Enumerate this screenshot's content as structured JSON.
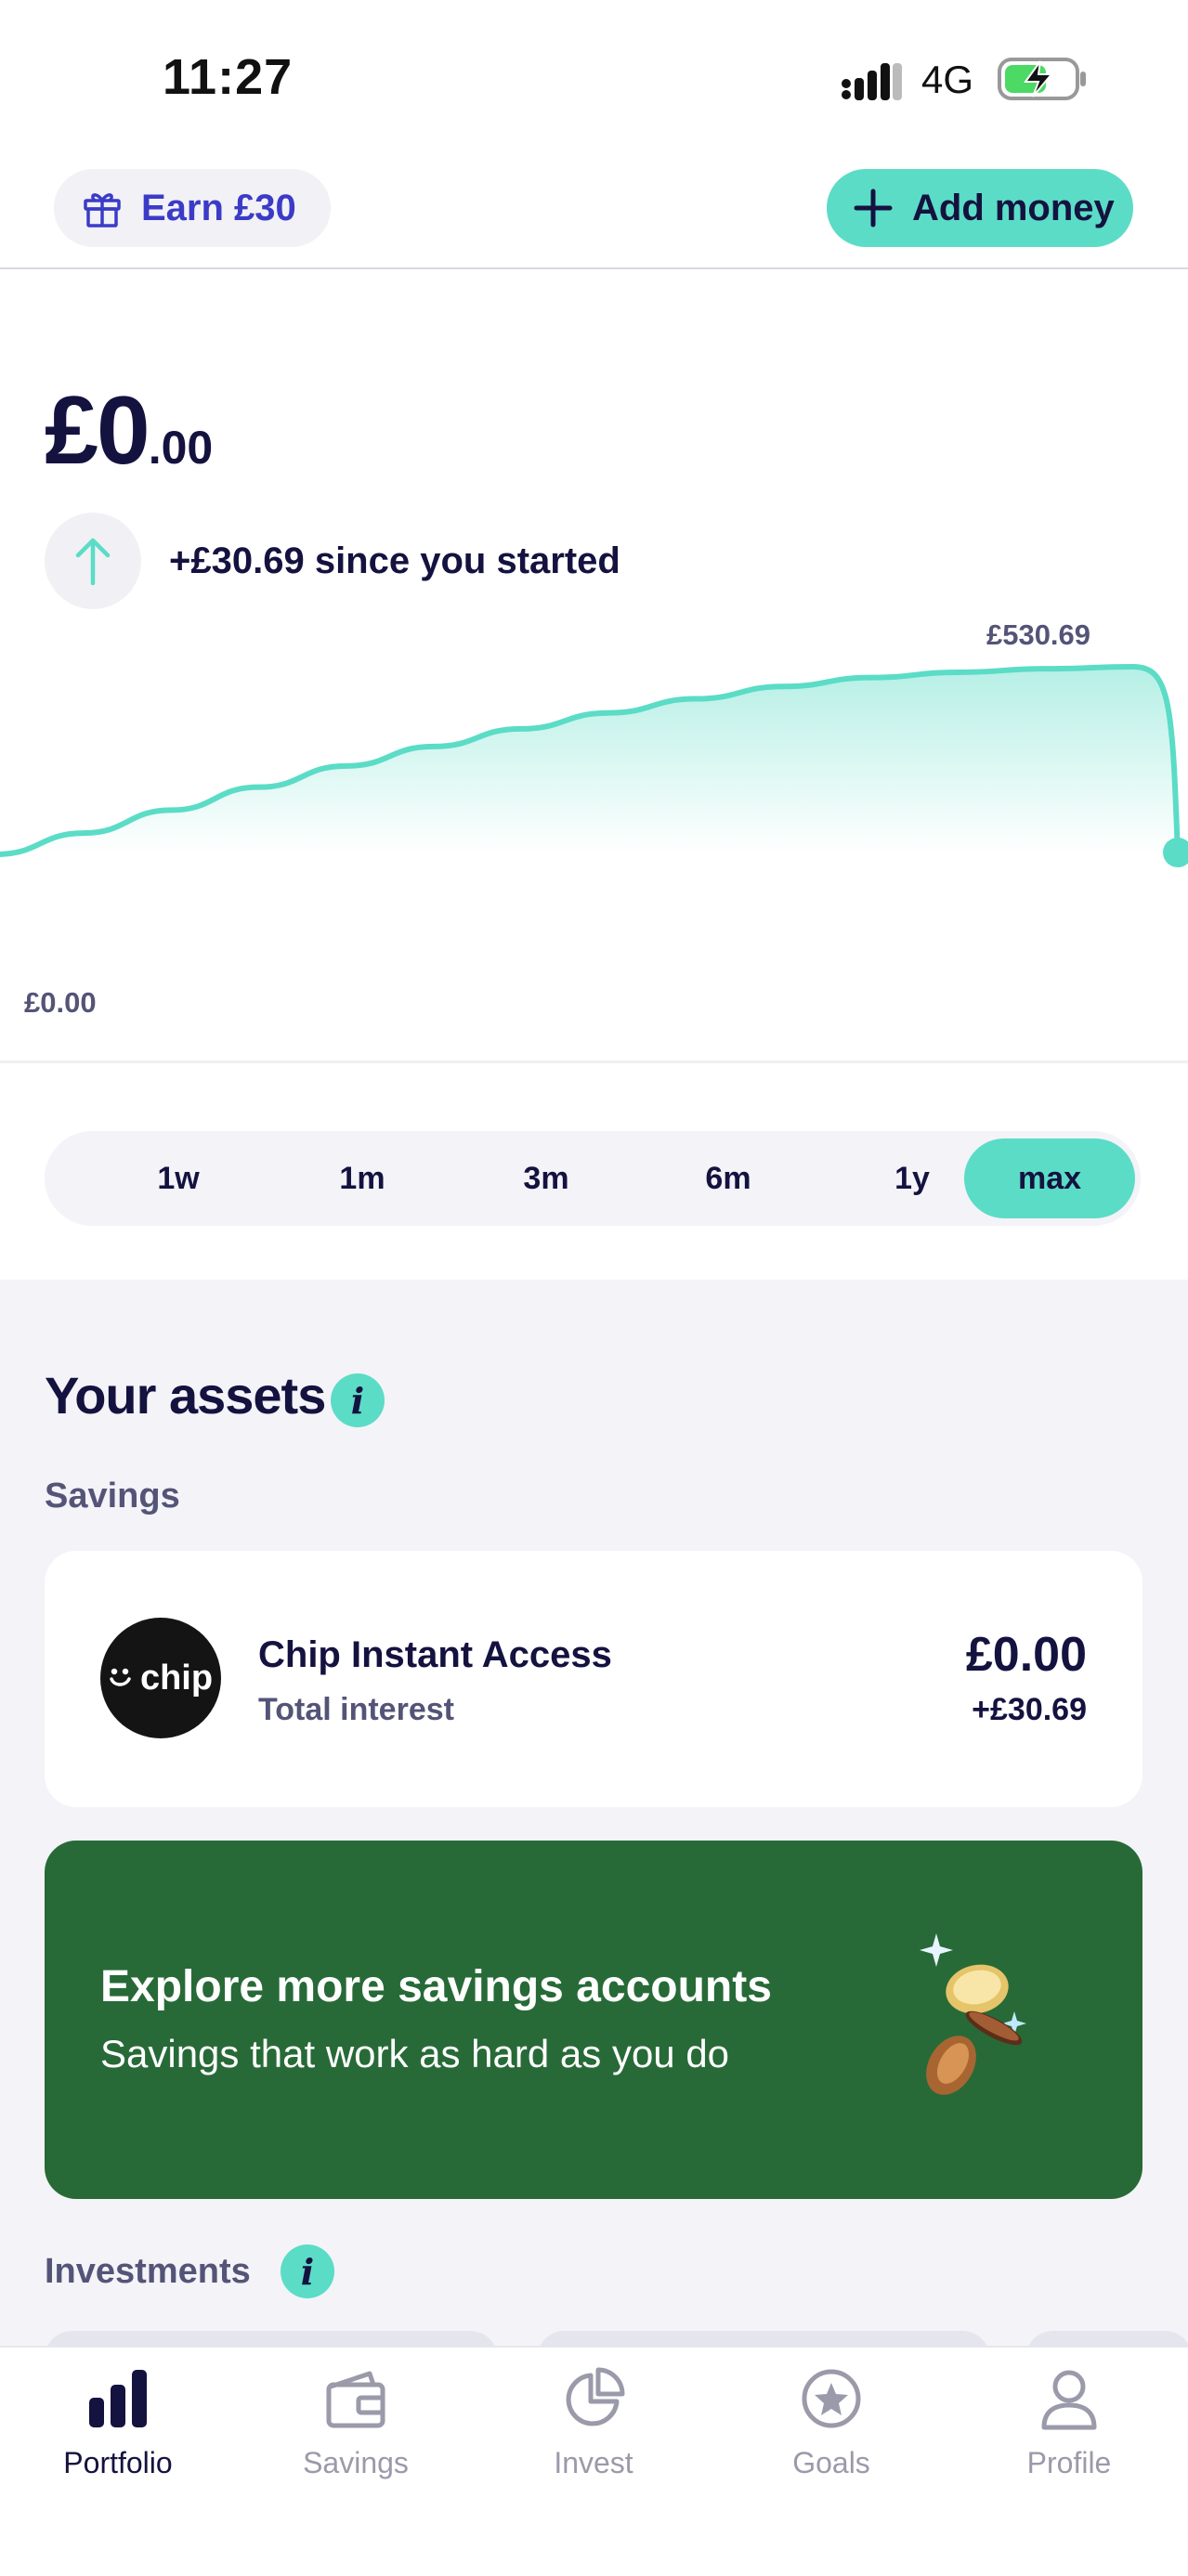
{
  "status_bar": {
    "time": "11:27",
    "network": "4G"
  },
  "header": {
    "earn_label": "Earn £30",
    "add_money_label": "Add money"
  },
  "balance": {
    "major": "£0",
    "minor": ".00",
    "growth_text": "+£30.69 since you started"
  },
  "chart_data": {
    "type": "area",
    "annotations": {
      "max_label": "£530.69",
      "min_label": "£0.00"
    },
    "values": [
      0,
      60,
      125,
      190,
      250,
      305,
      355,
      400,
      440,
      475,
      500,
      515,
      525,
      530.69,
      0
    ],
    "ylim": [
      0,
      530.69
    ],
    "colors": {
      "line": "#5bdcc6",
      "fill": "#5bdcc6"
    },
    "xlabel": "",
    "ylabel": ""
  },
  "ranges": {
    "items": [
      "1w",
      "1m",
      "3m",
      "6m",
      "1y",
      "max"
    ],
    "selected": "max"
  },
  "assets": {
    "title": "Your assets",
    "savings_label": "Savings",
    "account": {
      "logo_text": "chip",
      "name": "Chip Instant Access",
      "subtitle": "Total interest",
      "balance": "£0.00",
      "interest": "+£30.69"
    },
    "promo": {
      "title": "Explore more savings accounts",
      "subtitle": "Savings that work as hard as you do",
      "color": "#276a37"
    },
    "investments_label": "Investments"
  },
  "tabbar": {
    "items": [
      {
        "label": "Portfolio",
        "icon": "bar-chart-icon",
        "active": true
      },
      {
        "label": "Savings",
        "icon": "wallet-icon",
        "active": false
      },
      {
        "label": "Invest",
        "icon": "pie-chart-icon",
        "active": false
      },
      {
        "label": "Goals",
        "icon": "star-circle-icon",
        "active": false
      },
      {
        "label": "Profile",
        "icon": "person-icon",
        "active": false
      }
    ]
  },
  "colors": {
    "accent": "#5bdcc6",
    "navy": "#14123f",
    "link": "#3b3bc8"
  }
}
